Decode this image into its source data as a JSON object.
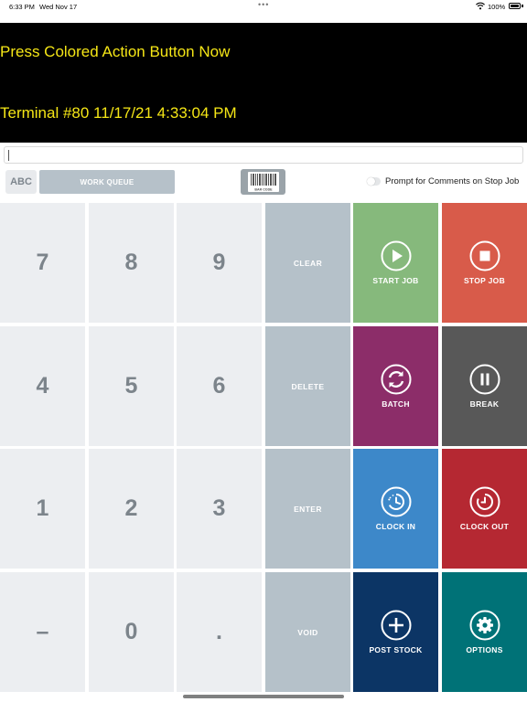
{
  "status_bar": {
    "time": "6:33 PM",
    "date": "Wed Nov 17",
    "dots": "•••",
    "battery_pct": "100%"
  },
  "display": {
    "message": "Press Colored Action Button Now",
    "terminal_line": "Terminal #80 11/17/21 4:33:04 PM",
    "text_color": "#f5e616"
  },
  "entry": {
    "value": ""
  },
  "toolbar": {
    "abc_label": "ABC",
    "work_queue_label": "WORK QUEUE",
    "barcode_text": "BAR CODE",
    "prompt_toggle_label": "Prompt for Comments on Stop Job",
    "prompt_toggle_on": false
  },
  "keypad": {
    "digits": [
      "7",
      "8",
      "9",
      "4",
      "5",
      "6",
      "1",
      "2",
      "3",
      "–",
      "0",
      "."
    ],
    "functions": [
      "CLEAR",
      "DELETE",
      "ENTER",
      "VOID"
    ]
  },
  "actions": [
    {
      "label": "START JOB",
      "color": "#86b97c",
      "icon": "play-icon"
    },
    {
      "label": "STOP JOB",
      "color": "#d85b4a",
      "icon": "stop-icon"
    },
    {
      "label": "BATCH",
      "color": "#8c2d69",
      "icon": "refresh-icon"
    },
    {
      "label": "BREAK",
      "color": "#585858",
      "icon": "pause-icon"
    },
    {
      "label": "CLOCK IN",
      "color": "#3d88c9",
      "icon": "clock-in-icon"
    },
    {
      "label": "CLOCK OUT",
      "color": "#b52832",
      "icon": "clock-out-icon"
    },
    {
      "label": "POST STOCK",
      "color": "#0c3565",
      "icon": "plus-icon"
    },
    {
      "label": "OPTIONS",
      "color": "#007277",
      "icon": "gear-icon"
    }
  ]
}
